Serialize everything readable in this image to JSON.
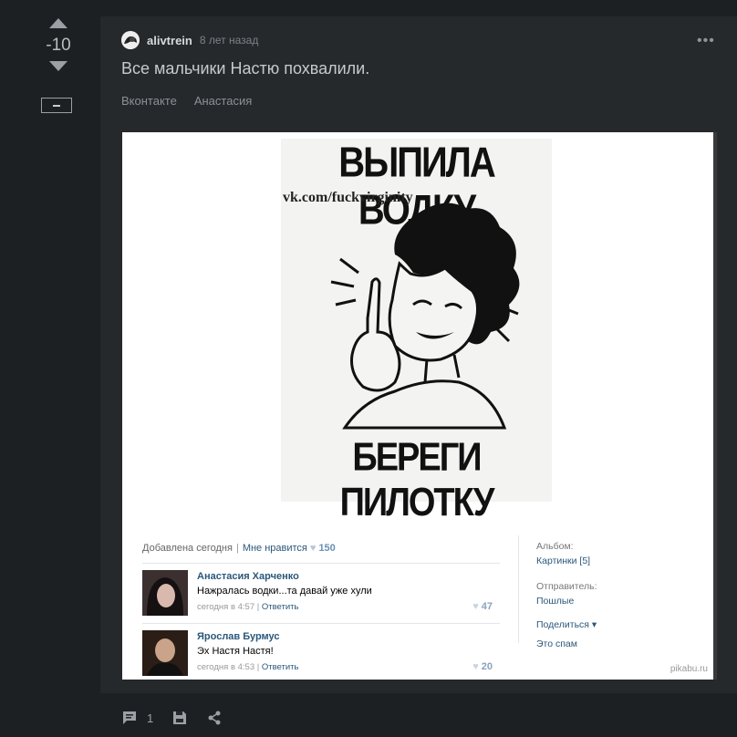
{
  "rating": {
    "value": "-10"
  },
  "post": {
    "author": "alivtrein",
    "time": "8 лет назад",
    "title": "Все мальчики Настю похвалили.",
    "tags": [
      "Вконтакте",
      "Анастасия"
    ]
  },
  "poster": {
    "top_text": "ВЫПИЛА ВОДКУ",
    "bottom_text": "БЕРЕГИ ПИЛОТКУ",
    "watermark": "vk.com/fuckvirginity"
  },
  "vk": {
    "added": "Добавлена сегодня",
    "like_label": "Мне нравится",
    "like_count": "150",
    "comments": [
      {
        "name": "Анастасия Харченко",
        "text": "Нажралась водки...та давай уже хули",
        "time": "сегодня в 4:57",
        "reply": "Ответить",
        "likes": "47"
      },
      {
        "name": "Ярослав Бурмус",
        "text": "Эх Настя Настя!",
        "time": "сегодня в 4:53",
        "reply": "Ответить",
        "likes": "20"
      }
    ],
    "album_label": "Альбом:",
    "album_value": "Картинки [5]",
    "sender_label": "Отправитель:",
    "sender_value": "Пошлые",
    "share": "Поделиться",
    "spam": "Это спам",
    "watermark": "pikabu.ru"
  },
  "footer": {
    "comments_count": "1"
  },
  "icons": [
    "arrow-up-icon",
    "arrow-down-icon",
    "collapse-icon",
    "more-icon",
    "comment-icon",
    "save-icon",
    "share-icon"
  ]
}
